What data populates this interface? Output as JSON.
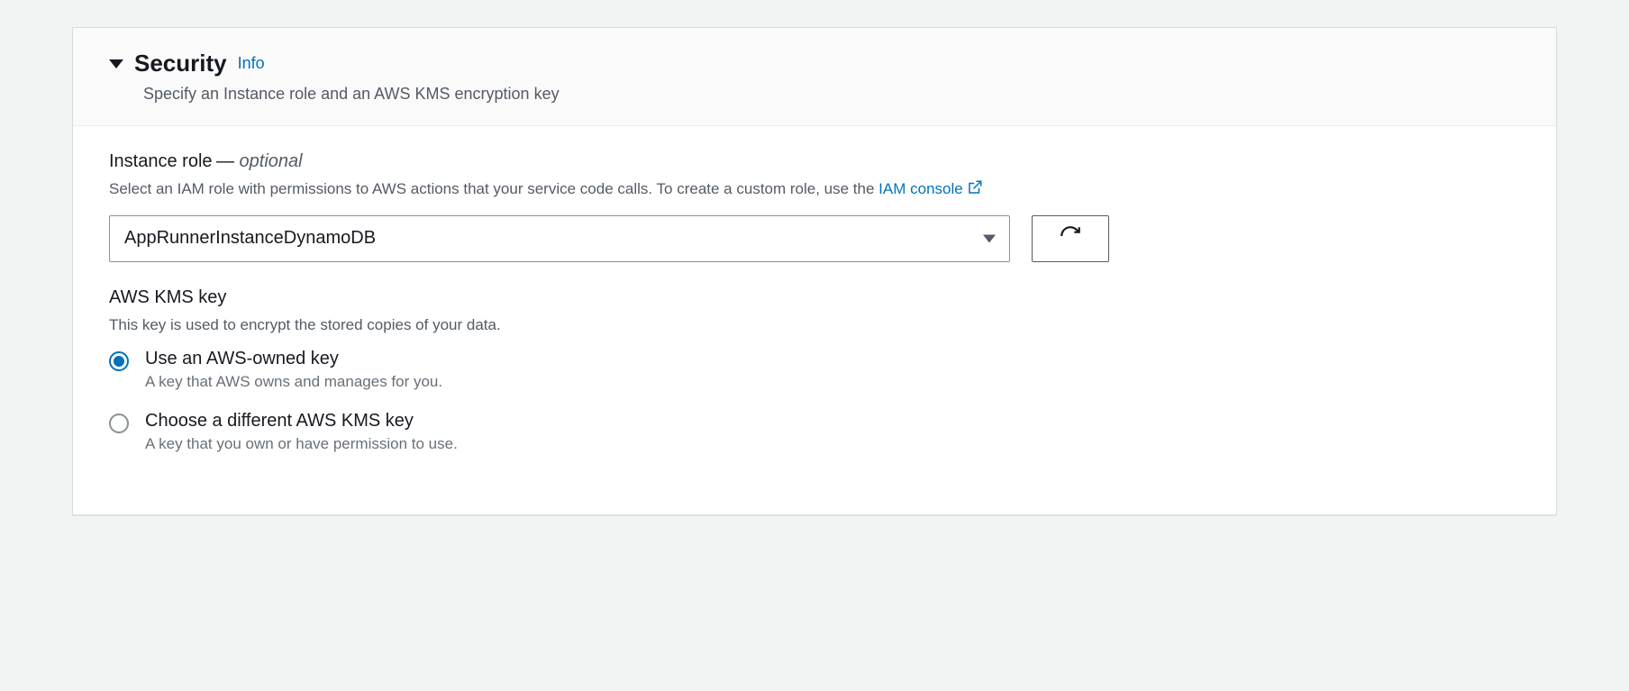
{
  "section": {
    "title": "Security",
    "info_label": "Info",
    "description": "Specify an Instance role and an AWS KMS encryption key"
  },
  "instance_role": {
    "label": "Instance role",
    "optional_suffix": "optional",
    "help_prefix": "Select an IAM role with permissions to AWS actions that your service code calls. To create a custom role, use the ",
    "help_link_text": "IAM console",
    "selected_value": "AppRunnerInstanceDynamoDB"
  },
  "kms": {
    "label": "AWS KMS key",
    "help": "This key is used to encrypt the stored copies of your data.",
    "options": [
      {
        "label": "Use an AWS-owned key",
        "description": "A key that AWS owns and manages for you.",
        "selected": true
      },
      {
        "label": "Choose a different AWS KMS key",
        "description": "A key that you own or have permission to use.",
        "selected": false
      }
    ]
  }
}
